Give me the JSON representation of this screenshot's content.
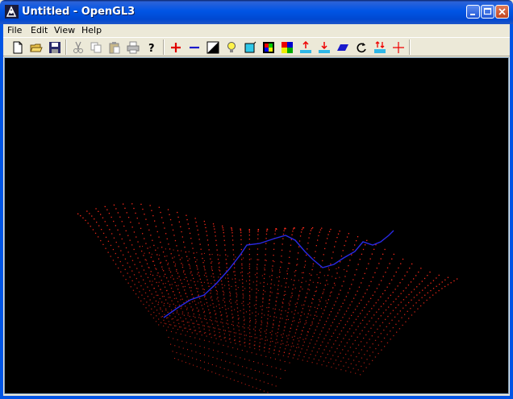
{
  "window": {
    "title": "Untitled - OpenGL3"
  },
  "menu": {
    "items": [
      "File",
      "Edit",
      "View",
      "Help"
    ]
  },
  "toolbar": {
    "buttons": [
      "new-document-icon",
      "open-folder-icon",
      "save-icon",
      "cut-icon",
      "copy-icon",
      "paste-icon",
      "print-icon",
      "help-icon",
      "zoom-in-plus-icon",
      "zoom-out-minus-icon",
      "contrast-icon",
      "light-bulb-icon",
      "frame-icon",
      "color-grid-icon",
      "color-palette-icon",
      "raise-level-icon",
      "lower-level-icon",
      "plane-icon",
      "rotate-icon",
      "level-arrows-icon",
      "crosshair-icon"
    ]
  },
  "scene": {
    "point_color": "#FF2A1A",
    "line_color": "#2A2AE6",
    "background": "#000000"
  },
  "colors": {
    "titlebar": "#0055E5",
    "chrome": "#ECE9D8"
  }
}
